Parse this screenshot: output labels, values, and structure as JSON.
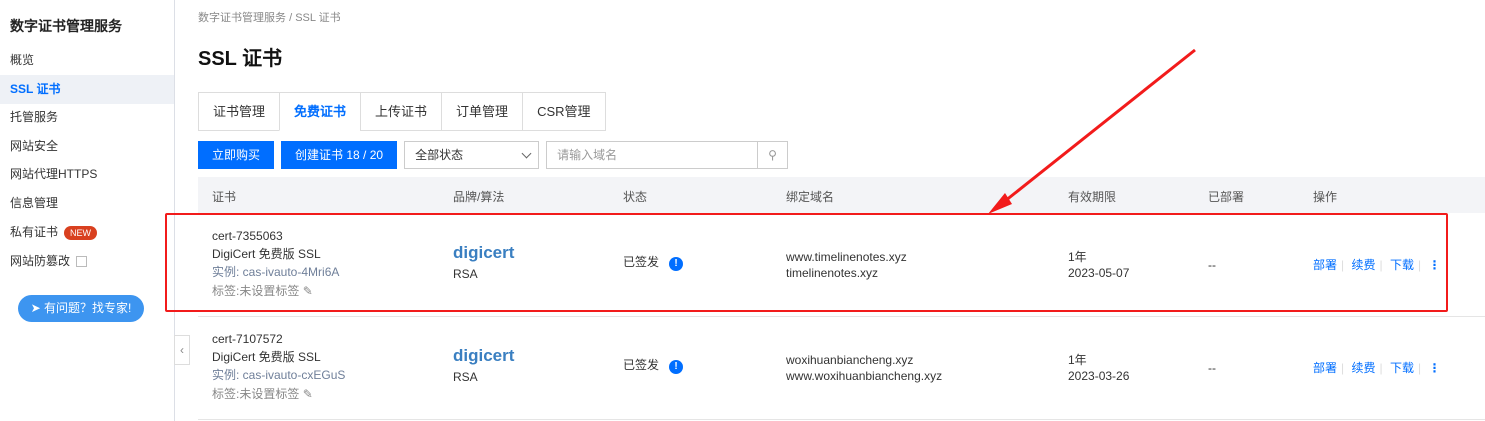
{
  "sidebar": {
    "title": "数字证书管理服务",
    "items": [
      "概览",
      "SSL 证书",
      "托管服务",
      "网站安全",
      "网站代理HTTPS",
      "信息管理",
      "私有证书",
      "网站防篡改"
    ],
    "new_badge": "NEW",
    "expert_button": "有问题？找专家!"
  },
  "breadcrumb": {
    "root": "数字证书管理服务",
    "sep": "/",
    "current": "SSL 证书"
  },
  "title": "SSL 证书",
  "tabs": [
    "证书管理",
    "免费证书",
    "上传证书",
    "订单管理",
    "CSR管理"
  ],
  "toolbar": {
    "buy": "立即购买",
    "create": "创建证书 18 / 20",
    "status_select": "全部状态",
    "search_placeholder": "请输入域名"
  },
  "columns": [
    "证书",
    "品牌/算法",
    "状态",
    "绑定域名",
    "有效期限",
    "已部署",
    "操作"
  ],
  "rows": [
    {
      "id": "cert-7355063",
      "product": "DigiCert 免费版 SSL",
      "instance": "实例: cas-ivauto-4Mri6A",
      "tag": "标签:未设置标签",
      "brand": "digicert",
      "algo": "RSA",
      "status": "已签发",
      "domains": [
        "www.timelinenotes.xyz",
        "timelinenotes.xyz"
      ],
      "period": "1年",
      "expiry": "2023-05-07",
      "deployed": "--",
      "ops": [
        "部署",
        "续费",
        "下载"
      ]
    },
    {
      "id": "cert-7107572",
      "product": "DigiCert 免费版 SSL",
      "instance": "实例: cas-ivauto-cxEGuS",
      "tag": "标签:未设置标签",
      "brand": "digicert",
      "algo": "RSA",
      "status": "已签发",
      "domains": [
        "woxihuanbiancheng.xyz",
        "www.woxihuanbiancheng.xyz"
      ],
      "period": "1年",
      "expiry": "2023-03-26",
      "deployed": "--",
      "ops": [
        "部署",
        "续费",
        "下载"
      ]
    }
  ],
  "colors": {
    "accent": "#006eff",
    "annotation": "#f21b1b"
  }
}
